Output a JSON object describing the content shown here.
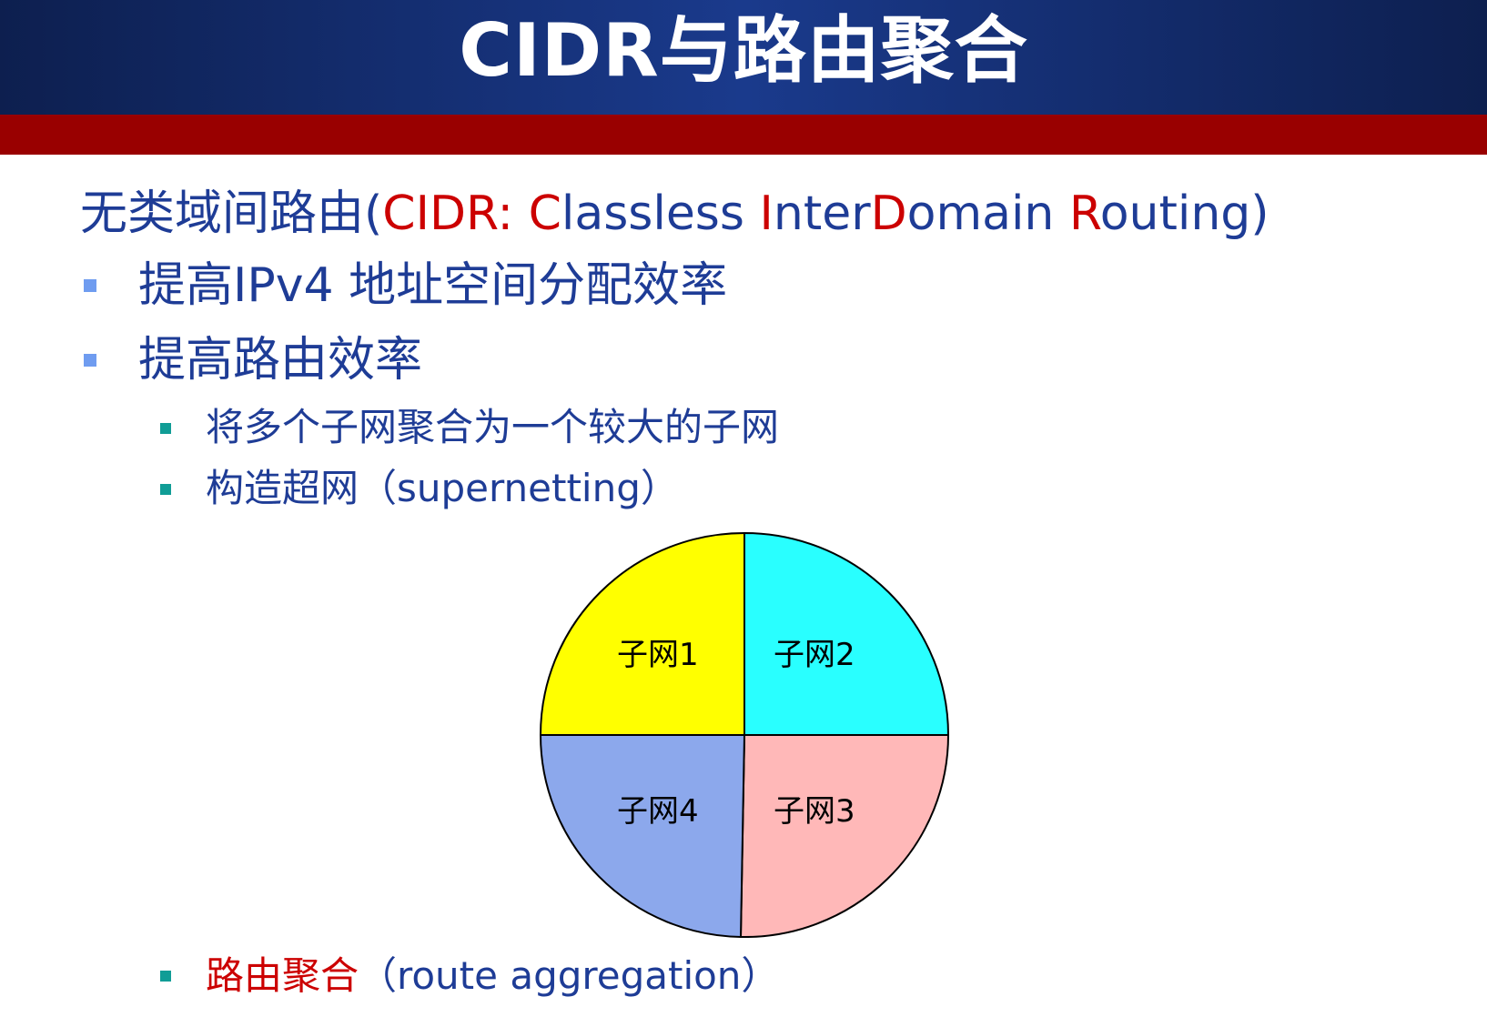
{
  "slide": {
    "title": "CIDR与路由聚合",
    "heading": {
      "prefix": "无类域间路由(",
      "parts": [
        {
          "text": "CIDR: ",
          "color": "red"
        },
        {
          "text": "C",
          "color": "red"
        },
        {
          "text": "lassless ",
          "color": "blue"
        },
        {
          "text": "I",
          "color": "red"
        },
        {
          "text": "nter",
          "color": "blue"
        },
        {
          "text": "D",
          "color": "red"
        },
        {
          "text": "omain ",
          "color": "blue"
        },
        {
          "text": "R",
          "color": "red"
        },
        {
          "text": "outing)",
          "color": "blue"
        }
      ]
    },
    "bullets_l1": [
      "提高IPv4 地址空间分配效率",
      "提高路由效率"
    ],
    "bullets_l2": [
      "将多个子网聚合为一个较大的子网",
      "构造超网（supernetting）"
    ],
    "bottom_bullet": {
      "red_part": "路由聚合",
      "blue_part": "（route aggregation）"
    },
    "diagram": {
      "quadrants": [
        {
          "label": "子网1",
          "color": "#ffff00"
        },
        {
          "label": "子网2",
          "color": "#29ffff"
        },
        {
          "label": "子网3",
          "color": "#ffb8b8"
        },
        {
          "label": "子网4",
          "color": "#8ca8ec"
        }
      ]
    }
  },
  "colors": {
    "header_bg": "#1a3a8c",
    "red_bar": "#990000",
    "text_blue": "#1e3c96",
    "text_red": "#cc0000"
  }
}
